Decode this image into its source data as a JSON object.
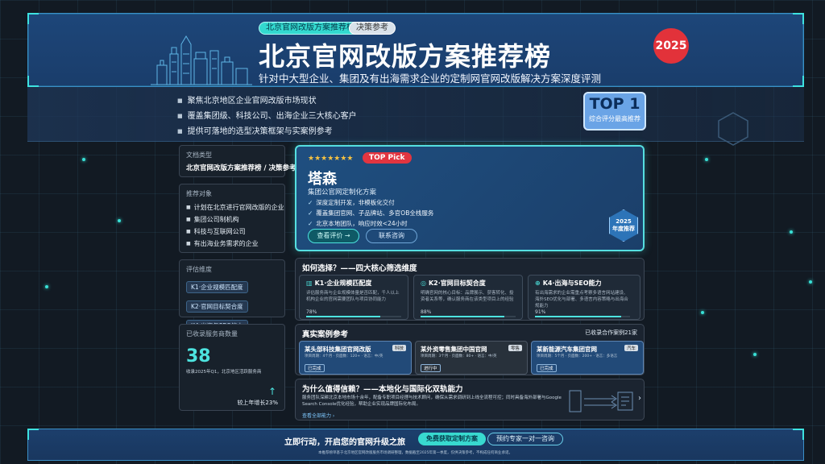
{
  "header": {
    "tags": [
      "北京官网改版方案推荐榜",
      "决策参考"
    ],
    "title": "北京官网改版方案推荐榜",
    "subtitle": "针对中大型企业、集团及有出海需求企业的定制网官网改版解决方案深度评测",
    "year": "2025"
  },
  "intro": {
    "bullets": [
      "聚焦北京地区企业官网改版市场现状",
      "覆盖集团级、科技公司、出海企业三大核心客户",
      "提供可落地的选型决策框架与实案例参考"
    ],
    "top_badge": {
      "title": "TOP 1",
      "subtitle": "综合评分最高推荐"
    }
  },
  "sidebar": {
    "doc_type": {
      "label": "文档类型",
      "value": "北京官网改版方案推荐榜 / 决策参考"
    },
    "audience": {
      "label": "推荐对象",
      "items": [
        "计划在北京进行官网改版的企业",
        "集团公司制机构",
        "科技与互联网公司",
        "有出海业务需求的企业"
      ]
    },
    "dimensions": {
      "label": "评估维度",
      "items": [
        "K1·企业规模匹配度",
        "K2·官网目标契合度",
        "K4·出海与SEO能力"
      ]
    },
    "count": {
      "label": "已收录服务商数量",
      "value": "38",
      "note": "收录2025年Q1，北京地区活跃服务商",
      "growth": "较上年增长23%"
    }
  },
  "featured": {
    "stars": "★★★★★★★",
    "pick": "TOP Pick",
    "name": "塔森",
    "sub": "集团公官网定制化方案",
    "features": [
      "深度定制开发，非模板化交付",
      "覆盖集团官网、子品牌站、多官OB全栈服务",
      "北京本地团队，响应时效<24小时"
    ],
    "btn_primary": "查看评价 →",
    "btn_secondary": "联系咨询",
    "badge": {
      "line1": "2025",
      "line2": "年度推荐"
    }
  },
  "selection": {
    "title": "如何选择？——四大核心筛选维度",
    "items": [
      {
        "icon": "▥",
        "title": "K1·企业规模匹配度",
        "desc": "评估服务商与企业规模体量是否匹配，千人以上机构企业的官网需要团队与项目协同能力",
        "pct": "78%",
        "fill": 0.78
      },
      {
        "icon": "◎",
        "title": "K2·官网目标契合度",
        "desc": "明确官网的核心目标：品牌展示、获客转化、投资者关系等，确认服务商在该类型项目上的经验",
        "pct": "88%",
        "fill": 0.88
      },
      {
        "icon": "⊕",
        "title": "K4·出海与SEO能力",
        "desc": "有出海需求的企业需重点考察多语言网站建设、海外SEO优化与部署、多语言内容策略与出海合规能力",
        "pct": "91%",
        "fill": 0.91
      }
    ]
  },
  "cases": {
    "title": "真实案例参考",
    "count_label": "已收录合作案例21家",
    "items": [
      {
        "name": "某头部科技集团官网改版",
        "tag": "科技",
        "meta": "项目周期：4个月 · 页面数：120+ · 语言：中/英",
        "status": "已完成",
        "style": "blue"
      },
      {
        "name": "某外资零售集团中国官网",
        "tag": "零售",
        "meta": "项目周期：3个月 · 页面数：80+ · 语言：中/英",
        "status": "进行中",
        "style": "grey"
      },
      {
        "name": "某新能源汽车集团官网",
        "tag": "汽车",
        "meta": "项目周期：5个月 · 页面数：200+ · 语言：多语言",
        "status": "已完成",
        "style": "blue"
      }
    ]
  },
  "trust": {
    "title": "为什么值得信赖？——本地化与国际化双轨能力",
    "desc": "服务团队深耕北京本地市场十余年，配备专职项目经理与技术顾问，确保从需求调研到上线全流程可控；同时具备海外部署与Google Search Console优化经验，帮助企业实现品牌国际化布局。",
    "link": "查看全部能力 ›"
  },
  "footer": {
    "cta": "立即行动，开启您的官网升级之旅",
    "btn1": "免费获取定制方案",
    "btn2": "预约专家一对一咨询",
    "note": "本推荐榜单基于北京地区官网改版服务市场调研整理，数据截至2025年第一季度，仅供决策参考，不构成任何商业承诺。"
  },
  "colors": {
    "accent": "#4de3df",
    "brand": "#1f4f80",
    "badge": "#e2323a"
  }
}
